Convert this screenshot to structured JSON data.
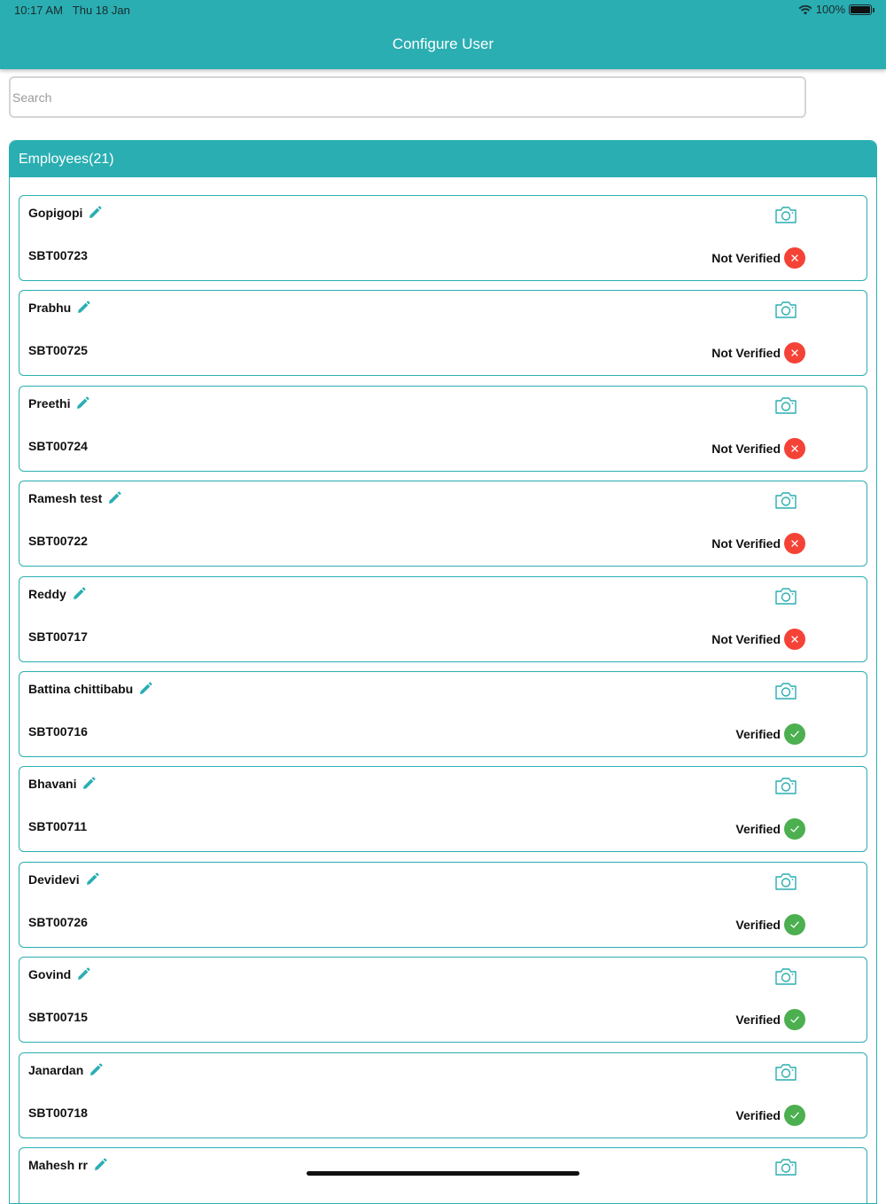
{
  "status_bar": {
    "time": "10:17 AM",
    "date": "Thu 18 Jan",
    "battery": "100%"
  },
  "header": {
    "title": "Configure User"
  },
  "search": {
    "placeholder": "Search"
  },
  "panel": {
    "title": "Employees(21)"
  },
  "colors": {
    "accent": "#2aaeb2",
    "verified": "#4caf50",
    "not_verified": "#f44336"
  },
  "icons": {
    "edit": "pencil-icon",
    "photo": "camera-icon",
    "verified": "check-circle-icon",
    "not_verified": "x-circle-icon"
  },
  "employees": [
    {
      "name": "Gopigopi",
      "id": "SBT00723",
      "status": "Not Verified",
      "verified": false
    },
    {
      "name": "Prabhu",
      "id": "SBT00725",
      "status": "Not Verified",
      "verified": false
    },
    {
      "name": "Preethi",
      "id": "SBT00724",
      "status": "Not Verified",
      "verified": false
    },
    {
      "name": "Ramesh test",
      "id": "SBT00722",
      "status": "Not Verified",
      "verified": false
    },
    {
      "name": "Reddy",
      "id": "SBT00717",
      "status": "Not Verified",
      "verified": false
    },
    {
      "name": "Battina chittibabu",
      "id": "SBT00716",
      "status": "Verified",
      "verified": true
    },
    {
      "name": "Bhavani",
      "id": "SBT00711",
      "status": "Verified",
      "verified": true
    },
    {
      "name": "Devidevi",
      "id": "SBT00726",
      "status": "Verified",
      "verified": true
    },
    {
      "name": "Govind",
      "id": "SBT00715",
      "status": "Verified",
      "verified": true
    },
    {
      "name": "Janardan",
      "id": "SBT00718",
      "status": "Verified",
      "verified": true
    },
    {
      "name": "Mahesh rr",
      "id": "",
      "status": "",
      "verified": true
    }
  ]
}
